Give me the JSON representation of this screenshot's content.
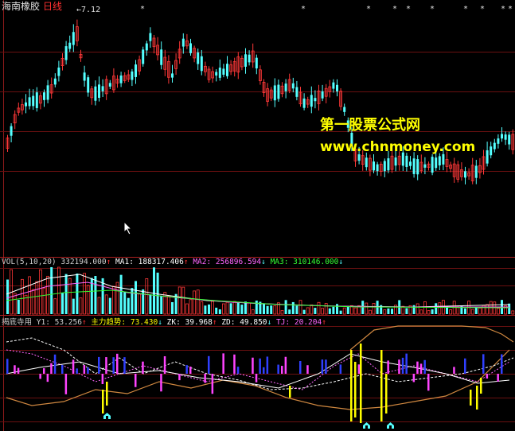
{
  "header": {
    "stock_name": "海南橡胶",
    "period": "日线",
    "peak_label": "←7.12",
    "stars": [
      "*",
      "*",
      "*",
      "*",
      "*",
      "*",
      "*",
      "*",
      "*",
      "*"
    ]
  },
  "watermark": {
    "line1": "第一股票公式网",
    "line2": "www.chnmoney.com"
  },
  "volume_panel": {
    "label": "VOL(5,10,20)",
    "value": "332194.000",
    "value_arrow": "↑",
    "ma1": "MA1: 188317.406",
    "ma1_arrow": "↑",
    "ma2": "MA2: 256896.594",
    "ma2_arrow": "↓",
    "ma3": "MA3: 310146.000",
    "ma3_arrow": "↓"
  },
  "indicator_panel": {
    "label": "揭底寺用",
    "y1": "Y1: 53.256",
    "y1_arrow": "↑",
    "zlqs": "主力趋势: 73.430",
    "zlqs_arrow": "↓",
    "zk": "ZK: 39.968",
    "zk_arrow": "↑",
    "zd": "ZD: 49.850",
    "zd_arrow": "↓",
    "tj": "TJ: 20.204",
    "tj_arrow": "↑"
  },
  "colors": {
    "up": "#ff3838",
    "down": "#54ffff",
    "grid": "#8a1a1a",
    "ma1": "#ffffff",
    "ma2": "#ff66ff",
    "ma3": "#33ff33",
    "yellow": "#ffff00"
  },
  "icons": [
    "arrow-cursor-icon",
    "house-icon"
  ]
}
